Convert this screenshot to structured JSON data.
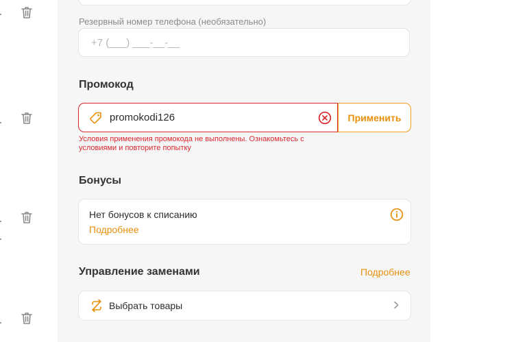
{
  "phone": {
    "label": "Резервный номер телефона (необязательно)",
    "placeholder": "+7 (___) ___-__-__"
  },
  "promo": {
    "title": "Промокод",
    "value": "promokodi126",
    "apply_label": "Применить",
    "error": "Условия применения промокода не выполнены. Ознакомьтесь с условиями и повторите попытку"
  },
  "bonuses": {
    "title": "Бонусы",
    "status": "Нет бонусов к списанию",
    "link": "Подробнее"
  },
  "replacements": {
    "title": "Управление заменами",
    "link": "Подробнее",
    "select_label": "Выбрать товары"
  },
  "colors": {
    "accent": "#e8900b",
    "error": "#d7282f",
    "panel_bg": "#f6f6f6"
  },
  "icons": [
    "trash-icon",
    "tag-icon",
    "clear-icon",
    "info-icon",
    "swap-icon",
    "chevron-right-icon"
  ]
}
